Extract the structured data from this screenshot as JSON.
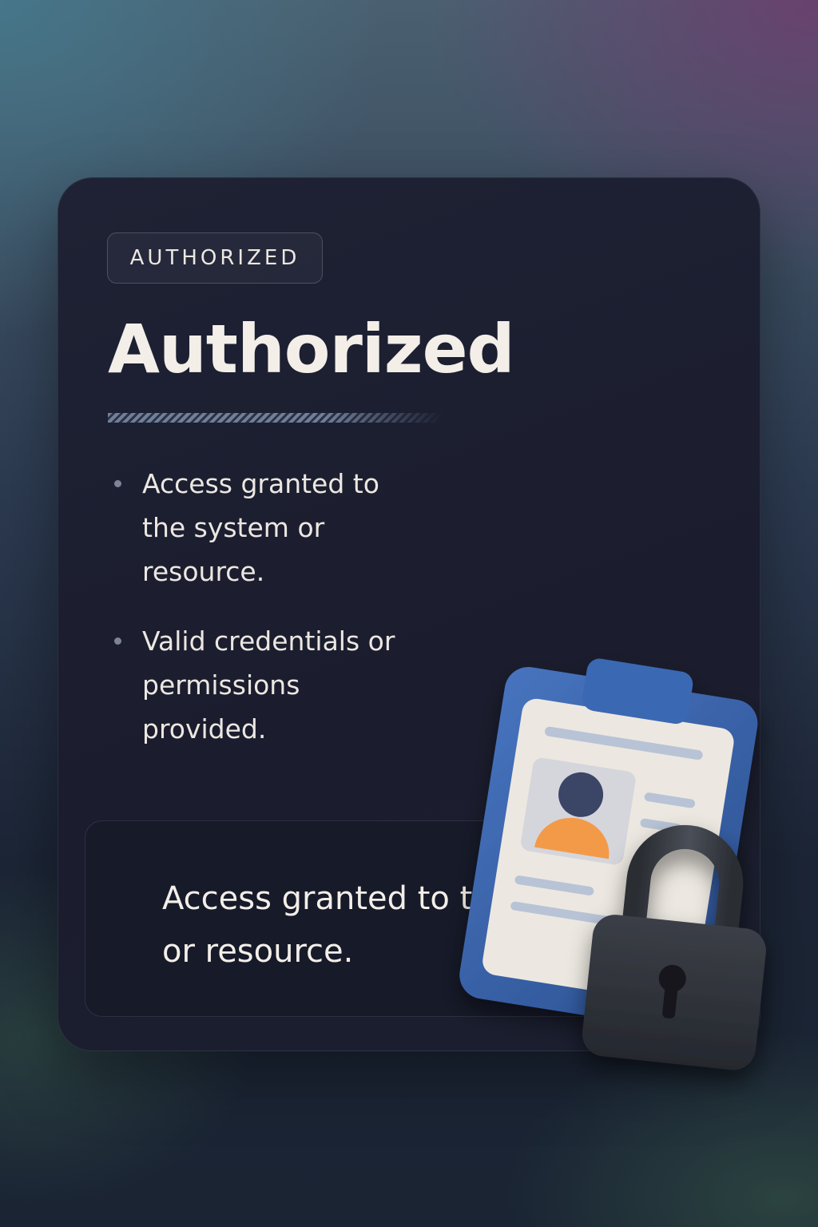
{
  "badge": {
    "label": "AUTHORIZED"
  },
  "header": {
    "title": "Authorized"
  },
  "bullets": [
    {
      "text": "Access granted to the system or resource."
    },
    {
      "text": "Valid credentials or permissions provided."
    }
  ],
  "note": {
    "text": "Access granted to the system or resource."
  },
  "illustration": {
    "icons": [
      "clipboard-icon",
      "id-card-icon",
      "user-avatar-icon",
      "padlock-icon",
      "keyhole-icon"
    ]
  },
  "colors": {
    "clipboard": "#355ea2",
    "card": "#ece8e1",
    "avatar_head": "#3a4466",
    "avatar_body": "#f39a4a",
    "padlock": "#2e3238",
    "text": "#ece7e1"
  }
}
